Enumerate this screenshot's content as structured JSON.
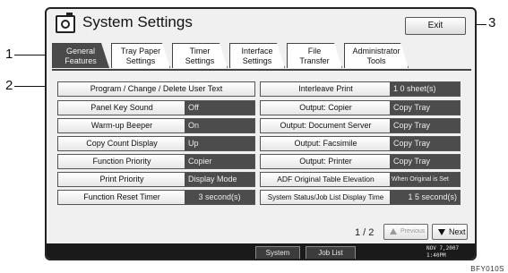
{
  "window": {
    "title": "System Settings",
    "exit_label": "Exit"
  },
  "tabs": [
    {
      "line1": "General",
      "line2": "Features",
      "active": true
    },
    {
      "line1": "Tray Paper",
      "line2": "Settings",
      "active": false
    },
    {
      "line1": "Timer",
      "line2": "Settings",
      "active": false
    },
    {
      "line1": "Interface",
      "line2": "Settings",
      "active": false
    },
    {
      "line1": "File",
      "line2": "Transfer",
      "active": false
    },
    {
      "line1": "Administrator",
      "line2": "Tools",
      "active": false
    }
  ],
  "left_settings": {
    "program_text": "Program / Change / Delete User Text",
    "items": [
      {
        "label": "Panel Key Sound",
        "value": "Off"
      },
      {
        "label": "Warm-up Beeper",
        "value": "On"
      },
      {
        "label": "Copy Count Display",
        "value": "Up"
      },
      {
        "label": "Function Priority",
        "value": "Copier"
      },
      {
        "label": "Print Priority",
        "value": "Display Mode"
      },
      {
        "label": "Function Reset Timer",
        "value": "3 second(s)"
      }
    ]
  },
  "right_settings": {
    "items": [
      {
        "label": "Interleave Print",
        "value": "1 0 sheet(s)"
      },
      {
        "label": "Output: Copier",
        "value": "Copy Tray"
      },
      {
        "label": "Output: Document Server",
        "value": "Copy Tray"
      },
      {
        "label": "Output: Facsimile",
        "value": "Copy Tray"
      },
      {
        "label": "Output: Printer",
        "value": "Copy Tray"
      },
      {
        "label": "ADF Original Table Elevation",
        "value": "When Original is Set"
      },
      {
        "label": "System Status/Job List Display Time",
        "value": "1 5 second(s)"
      }
    ]
  },
  "pager": {
    "page": "1 / 2",
    "previous_label": "Previous",
    "next_label": "Next"
  },
  "statusbar": {
    "system_status_label": "System Status",
    "job_list_label": "Job List",
    "date": "NOV   7,2007",
    "time": "1:40PM"
  },
  "callouts": {
    "c1": "1",
    "c2": "2",
    "c3": "3"
  },
  "figure_code": "BFY010S",
  "colors": {
    "active_tab": "#4a4a4a",
    "value_bg": "#4c4c4c",
    "status_bar": "#1a1a1a"
  }
}
